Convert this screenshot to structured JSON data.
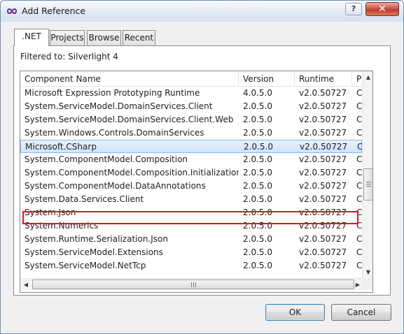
{
  "window": {
    "title": "Add Reference",
    "help_label": "?",
    "close_label": "✕"
  },
  "tabs": [
    {
      "label": ".NET",
      "active": true
    },
    {
      "label": "Projects",
      "active": false
    },
    {
      "label": "Browse",
      "active": false
    },
    {
      "label": "Recent",
      "active": false
    }
  ],
  "filter_text": "Filtered to: Silverlight 4",
  "list": {
    "columns": [
      "Component Name",
      "Version",
      "Runtime",
      "P"
    ],
    "rows": [
      {
        "name": "Microsoft Expression Prototyping Runtime",
        "version": "4.0.5.0",
        "runtime": "v2.0.50727",
        "path": "C"
      },
      {
        "name": "System.ServiceModel.DomainServices.Client",
        "version": "2.0.5.0",
        "runtime": "v2.0.50727",
        "path": "C"
      },
      {
        "name": "System.ServiceModel.DomainServices.Client.Web",
        "version": "2.0.5.0",
        "runtime": "v2.0.50727",
        "path": "C"
      },
      {
        "name": "System.Windows.Controls.DomainServices",
        "version": "2.0.5.0",
        "runtime": "v2.0.50727",
        "path": "C"
      },
      {
        "name": "Microsoft.CSharp",
        "version": "2.0.5.0",
        "runtime": "v2.0.50727",
        "path": "C",
        "selected": true
      },
      {
        "name": "System.ComponentModel.Composition",
        "version": "2.0.5.0",
        "runtime": "v2.0.50727",
        "path": "C"
      },
      {
        "name": "System.ComponentModel.Composition.Initialization",
        "version": "2.0.5.0",
        "runtime": "v2.0.50727",
        "path": "C"
      },
      {
        "name": "System.ComponentModel.DataAnnotations",
        "version": "2.0.5.0",
        "runtime": "v2.0.50727",
        "path": "C"
      },
      {
        "name": "System.Data.Services.Client",
        "version": "2.0.5.0",
        "runtime": "v2.0.50727",
        "path": "C"
      },
      {
        "name": "System.Json",
        "version": "2.0.5.0",
        "runtime": "v2.0.50727",
        "path": "C"
      },
      {
        "name": "System.Numerics",
        "version": "2.0.5.0",
        "runtime": "v2.0.50727",
        "path": "C"
      },
      {
        "name": "System.Runtime.Serialization.Json",
        "version": "2.0.5.0",
        "runtime": "v2.0.50727",
        "path": "C"
      },
      {
        "name": "System.ServiceModel.Extensions",
        "version": "2.0.5.0",
        "runtime": "v2.0.50727",
        "path": "C"
      },
      {
        "name": "System.ServiceModel.NetTcp",
        "version": "2.0.5.0",
        "runtime": "v2.0.50727",
        "path": "C"
      }
    ]
  },
  "buttons": {
    "ok": "OK",
    "cancel": "Cancel"
  },
  "colors": {
    "highlight_box": "#e2161f",
    "selection": "#cfe3fa"
  }
}
